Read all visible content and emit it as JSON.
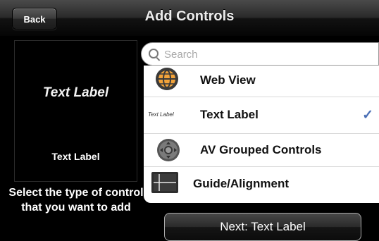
{
  "navbar": {
    "back_label": "Back",
    "title": "Add Controls"
  },
  "preview": {
    "italic_label": "Text Label",
    "plain_label": "Text Label"
  },
  "instructions": "Select the type of control that you want to add",
  "search": {
    "placeholder": "Search"
  },
  "list": {
    "items": [
      {
        "label": "Web View",
        "icon": "globe-icon",
        "selected": false
      },
      {
        "label": "Text Label",
        "icon": "text-label-icon",
        "icon_text": "Text Label",
        "selected": true
      },
      {
        "label": "AV Grouped Controls",
        "icon": "dpad-icon",
        "selected": false
      },
      {
        "label": "Guide/Alignment",
        "icon": "guide-icon",
        "selected": false
      }
    ],
    "check_glyph": "✓"
  },
  "next_button": {
    "label": "Next: Text Label"
  },
  "colors": {
    "accent_check": "#4a6fb5",
    "globe_orange": "#f2a33a"
  }
}
